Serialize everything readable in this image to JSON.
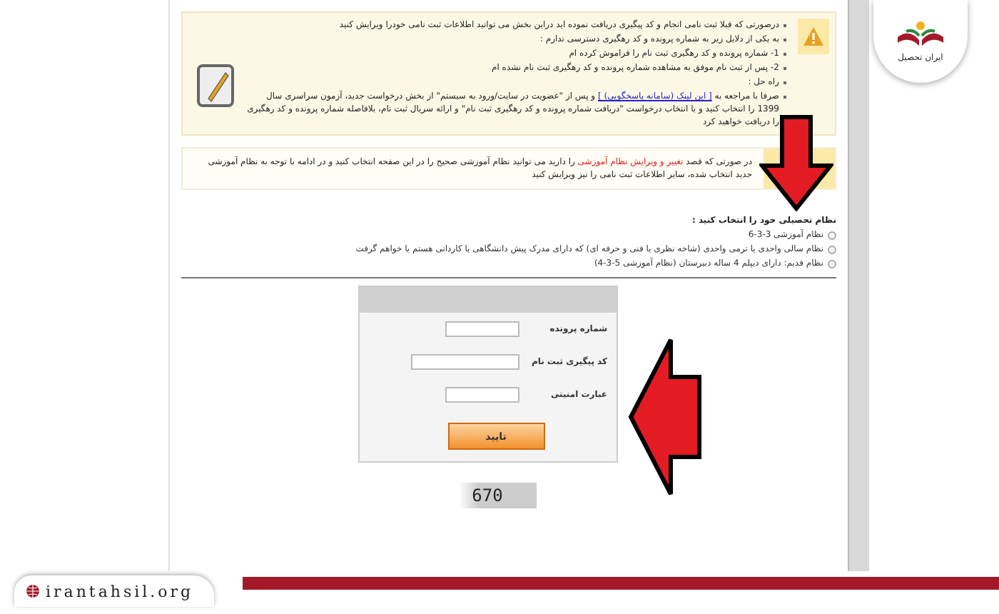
{
  "brand": {
    "logo_text": "ایران تحصیل",
    "website": "irantahsil.org"
  },
  "notice": {
    "lines": [
      "درصورتی که قبلا ثبت نامی انجام و کد پیگیری دریافت نموده اید دراین بخش می توانید اطلاعات ثبت نامی خودرا ویرایش کنید",
      "به یکی از دلایل زیر به شماره پرونده و کد رهگیری دسترسی ندارم :",
      "1- شماره پرونده و کد رهگیری ثبت نام را فراموش کرده ام",
      "2- پس از ثبت نام موفق به مشاهده شماره پرونده و کد رهگیری ثبت نام نشده ام",
      "راه حل :"
    ],
    "solution": {
      "before": "صرفا با مراجعه به",
      "link": "[ این لینک (سامانه پاسخگویی) ]",
      "after": "و پس از \"عضویت در سایت/ورود به سیستم\" از بخش درخواست جدید، آزمون سراسری سال 1399 را انتخاب کنید و با انتخاب درخواست \"دریافت شماره پرونده و کد رهگیری ثبت نام\" و ارائه سریال ثبت نام، بلافاصله شماره پرونده و کد رهگیری را دریافت خواهید کرد"
    }
  },
  "edit_notice": {
    "before": "در صورتی که قصد",
    "highlight": "تغییر و ویرایش نظام آموزشی",
    "after": "را دارید می توانید نظام آموزشی صحیح را در این صفحه انتخاب کنید و در ادامه با توجه به نظام آموزشی جدید انتخاب شده، سایر اطلاعات ثبت نامی را نیز ویرایش کنید"
  },
  "education_system": {
    "heading": "نظام تحصیلی خود را انتخاب کنید :",
    "options": [
      {
        "label": "نظام آموزشی 3-3-6",
        "selected": false
      },
      {
        "label": "نظام سالی واحدی یا ترمی واحدی (شاخه نظری یا فنی و حرفه ای) که دارای مدرک پیش دانشگاهی یا کاردانی هستم یا خواهم گرفت",
        "selected": false
      },
      {
        "label": "نظام قدیم: دارای دیپلم 4 ساله دبیرستان (نظام آموزشی 5-3-4)",
        "selected": false
      }
    ]
  },
  "form": {
    "fields": [
      {
        "label": "شماره پرونده",
        "kind": "short"
      },
      {
        "label": "کد پیگیری ثبت نام",
        "kind": "long"
      },
      {
        "label": "عبارت امنیتی",
        "kind": "short"
      }
    ],
    "submit": "تایید",
    "captcha": "670"
  }
}
